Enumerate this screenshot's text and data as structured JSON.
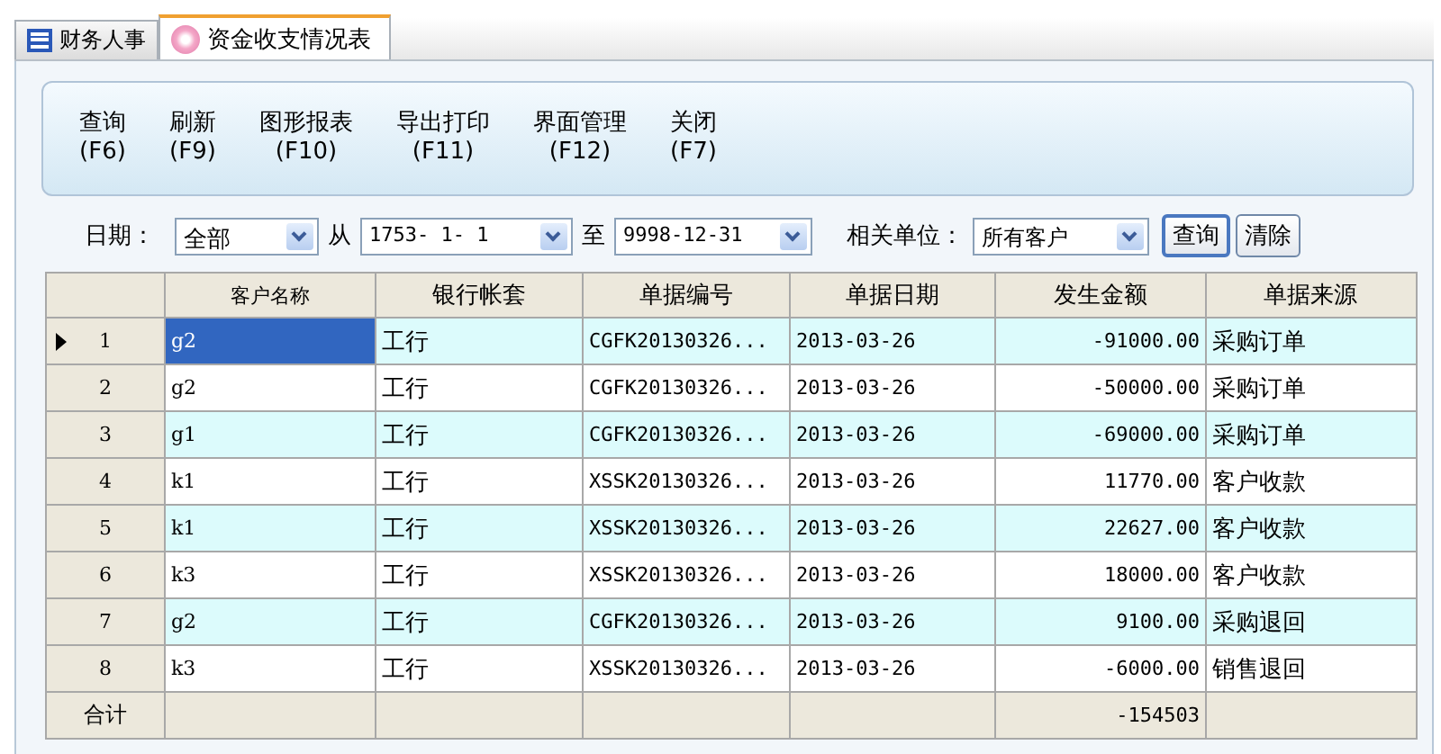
{
  "tabs": [
    {
      "label": "财务人事",
      "selected": false
    },
    {
      "label": "资金收支情况表",
      "selected": true
    }
  ],
  "toolbar": [
    {
      "label": "查询",
      "key": "(F6)"
    },
    {
      "label": "刷新",
      "key": "(F9)"
    },
    {
      "label": "图形报表",
      "key": "(F10)"
    },
    {
      "label": "导出打印",
      "key": "(F11)"
    },
    {
      "label": "界面管理",
      "key": "(F12)"
    },
    {
      "label": "关闭",
      "key": "(F7)"
    }
  ],
  "filters": {
    "date_label": "日期：",
    "date_range": "全部",
    "from_label": "从",
    "from": "1753- 1- 1",
    "to_label": "至",
    "to": "9998-12-31",
    "unit_label": "相关单位：",
    "unit": "所有客户",
    "buttons": [
      {
        "label": "查询",
        "focused": true
      },
      {
        "label": "清除",
        "focused": false
      }
    ]
  },
  "table": {
    "columns": [
      "客户名称",
      "银行帐套",
      "单据编号",
      "单据日期",
      "发生金额",
      "单据来源"
    ],
    "rows": [
      {
        "number": "1",
        "selected": true,
        "cells": [
          "g2",
          "工行",
          "CGFK20130326...",
          "2013-03-26",
          "-91000.00",
          "采购订单"
        ]
      },
      {
        "number": "2",
        "selected": false,
        "cells": [
          "g2",
          "工行",
          "CGFK20130326...",
          "2013-03-26",
          "-50000.00",
          "采购订单"
        ]
      },
      {
        "number": "3",
        "selected": false,
        "cells": [
          "g1",
          "工行",
          "CGFK20130326...",
          "2013-03-26",
          "-69000.00",
          "采购订单"
        ]
      },
      {
        "number": "4",
        "selected": false,
        "cells": [
          "k1",
          "工行",
          "XSSK20130326...",
          "2013-03-26",
          "11770.00",
          "客户收款"
        ]
      },
      {
        "number": "5",
        "selected": false,
        "cells": [
          "k1",
          "工行",
          "XSSK20130326...",
          "2013-03-26",
          "22627.00",
          "客户收款"
        ]
      },
      {
        "number": "6",
        "selected": false,
        "cells": [
          "k3",
          "工行",
          "XSSK20130326...",
          "2013-03-26",
          "18000.00",
          "客户收款"
        ]
      },
      {
        "number": "7",
        "selected": false,
        "cells": [
          "g2",
          "工行",
          "CGFK20130326...",
          "2013-03-26",
          "9100.00",
          "采购退回"
        ]
      },
      {
        "number": "8",
        "selected": false,
        "cells": [
          "k3",
          "工行",
          "XSSK20130326...",
          "2013-03-26",
          "-6000.00",
          "销售退回"
        ]
      }
    ],
    "total": {
      "label": "合计",
      "amount": "-154503"
    }
  }
}
